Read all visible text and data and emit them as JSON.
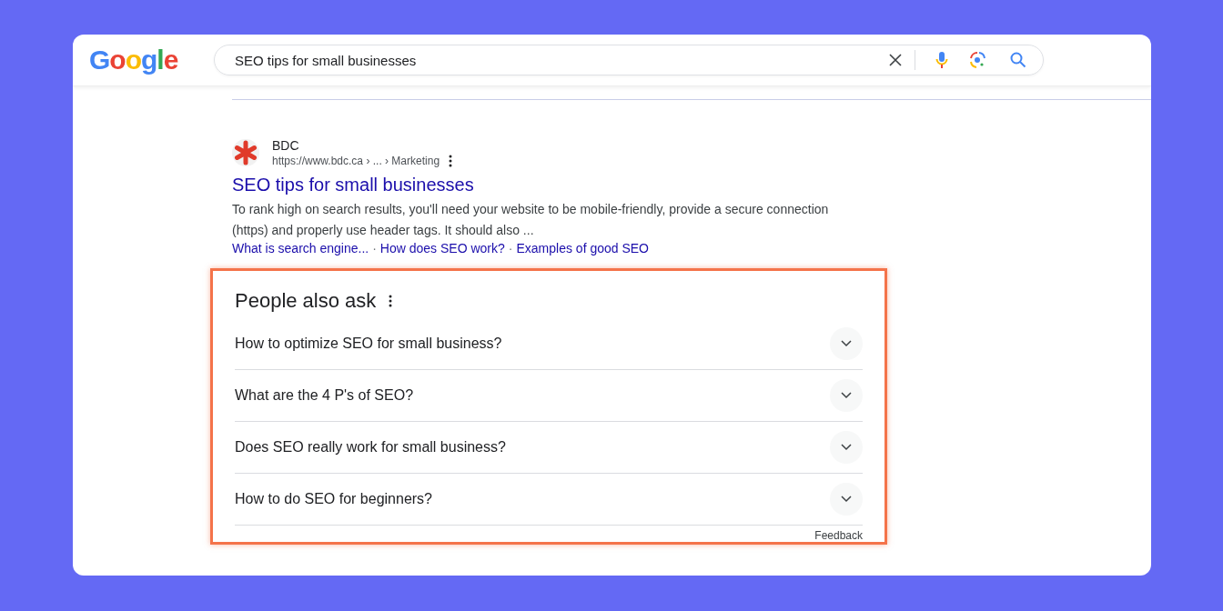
{
  "header": {
    "logo": "Google",
    "search": {
      "value": "SEO tips for small businesses"
    }
  },
  "result": {
    "site": "BDC",
    "url": "https://www.bdc.ca › ... › Marketing",
    "title": "SEO tips for small businesses",
    "snippet": "To rank high on search results, you'll need your website to be mobile-friendly, provide a secure connection (https) and properly use header tags. It should also ...",
    "separator": "·",
    "sitelinks": [
      "What is search engine...",
      "How does SEO work?",
      "Examples of good SEO"
    ]
  },
  "people_also_ask": {
    "title": "People also ask",
    "highlighted": true,
    "questions": [
      {
        "text": "How to optimize SEO for small business?",
        "expanded": false
      },
      {
        "text": "What are the 4 P's of SEO?",
        "expanded": false
      },
      {
        "text": "Does SEO really work for small business?",
        "expanded": false
      },
      {
        "text": "How to do SEO for beginners?",
        "expanded": false
      }
    ],
    "feedback": "Feedback"
  }
}
